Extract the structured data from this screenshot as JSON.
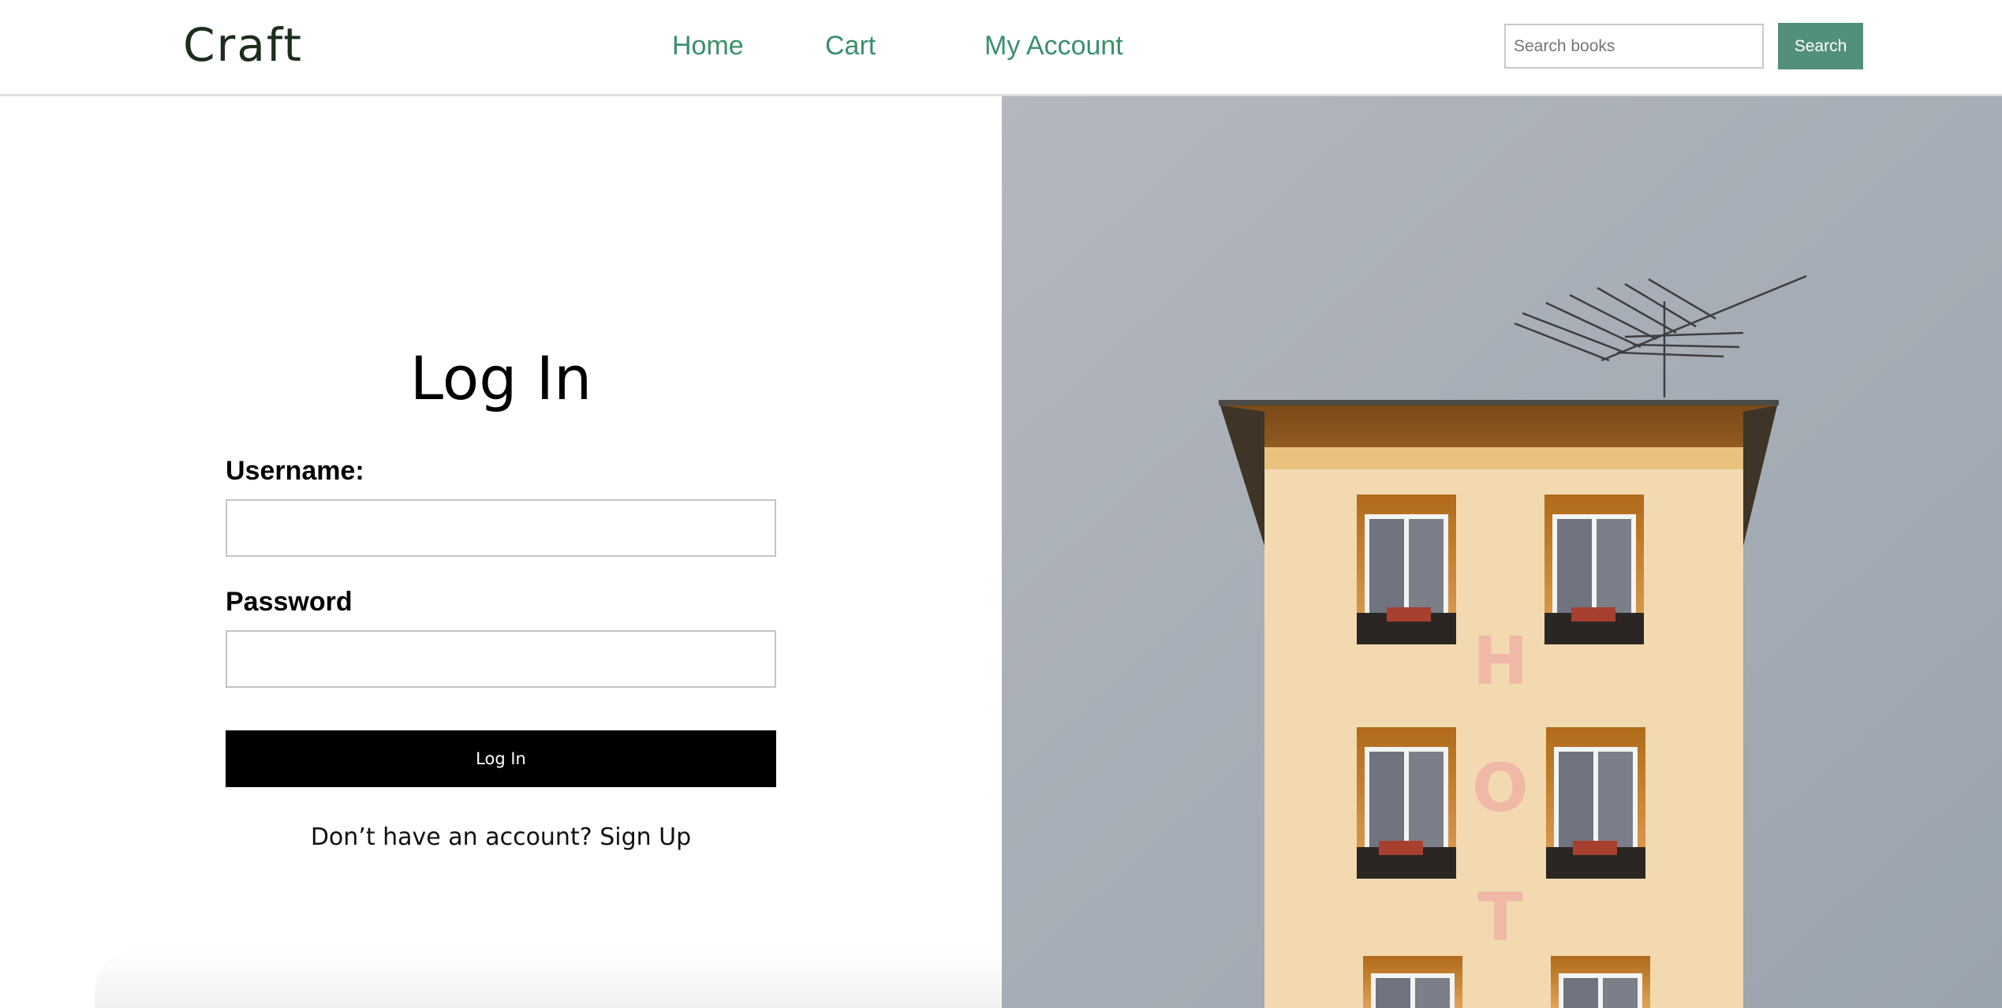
{
  "header": {
    "logo": "Craft",
    "nav": {
      "home": "Home",
      "cart": "Cart",
      "account": "My Account"
    },
    "search": {
      "placeholder": "Search books",
      "button_label": "Search"
    }
  },
  "login": {
    "title": "Log In",
    "username_label": "Username:",
    "password_label": "Password",
    "submit_label": "Log In",
    "signup_prompt": "Don’t have an account?",
    "signup_link": "Sign Up"
  },
  "hero": {
    "sign_letters": [
      "H",
      "O",
      "T"
    ]
  },
  "colors": {
    "accent": "#3a8f6b",
    "search_button": "#52907c",
    "building_wall": "#f2d9b0",
    "sky": "#a9b0b8"
  }
}
